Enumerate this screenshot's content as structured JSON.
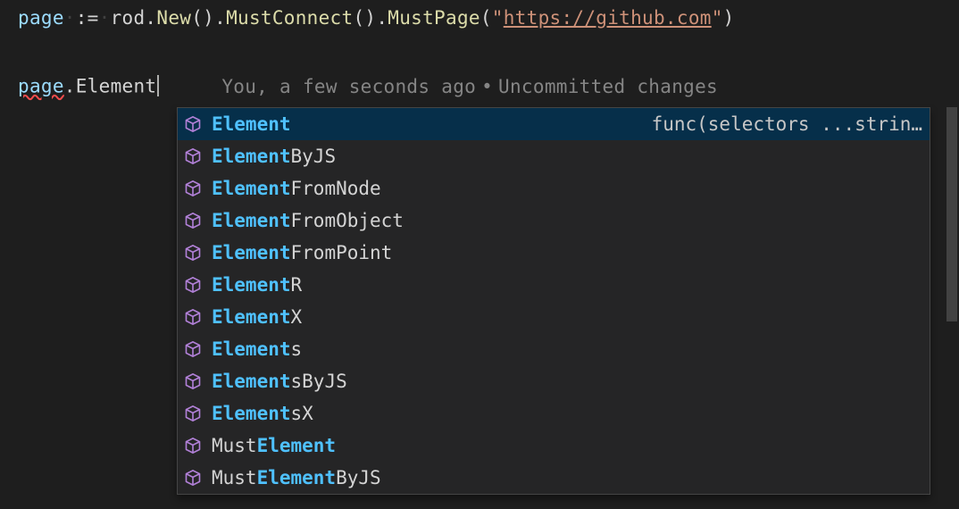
{
  "code": {
    "line1": {
      "page": "page",
      "assign": " := ",
      "rod": "rod",
      "dot1": ".",
      "new": "New",
      "parens1": "()",
      "dot2": ".",
      "mustconnect": "MustConnect",
      "parens2": "()",
      "dot3": ".",
      "mustpage": "MustPage",
      "open_paren": "(",
      "quote1": "\"",
      "url": "https://github.com",
      "quote2": "\"",
      "close_paren": ")"
    },
    "line2": {
      "page": "page",
      "dot": ".",
      "typed": "Element"
    }
  },
  "codelens": {
    "author": "You, a few seconds ago",
    "status": "Uncommitted changes"
  },
  "autocomplete": {
    "items": [
      {
        "match": "Element",
        "prefix": "",
        "suffix": "",
        "detail": "func(selectors ...strin…",
        "selected": true
      },
      {
        "match": "Element",
        "prefix": "",
        "suffix": "ByJS",
        "detail": "",
        "selected": false
      },
      {
        "match": "Element",
        "prefix": "",
        "suffix": "FromNode",
        "detail": "",
        "selected": false
      },
      {
        "match": "Element",
        "prefix": "",
        "suffix": "FromObject",
        "detail": "",
        "selected": false
      },
      {
        "match": "Element",
        "prefix": "",
        "suffix": "FromPoint",
        "detail": "",
        "selected": false
      },
      {
        "match": "Element",
        "prefix": "",
        "suffix": "R",
        "detail": "",
        "selected": false
      },
      {
        "match": "Element",
        "prefix": "",
        "suffix": "X",
        "detail": "",
        "selected": false
      },
      {
        "match": "Element",
        "prefix": "",
        "suffix": "s",
        "detail": "",
        "selected": false
      },
      {
        "match": "Element",
        "prefix": "",
        "suffix": "sByJS",
        "detail": "",
        "selected": false
      },
      {
        "match": "Element",
        "prefix": "",
        "suffix": "sX",
        "detail": "",
        "selected": false
      },
      {
        "match": "Element",
        "prefix": "Must",
        "suffix": "",
        "detail": "",
        "selected": false
      },
      {
        "match": "Element",
        "prefix": "Must",
        "suffix": "ByJS",
        "detail": "",
        "selected": false
      }
    ]
  },
  "icons": {
    "method": "cube-icon"
  },
  "colors": {
    "method_icon": "#b180d7",
    "selected_bg": "#062f4a",
    "match_color": "#4fc1ff"
  }
}
